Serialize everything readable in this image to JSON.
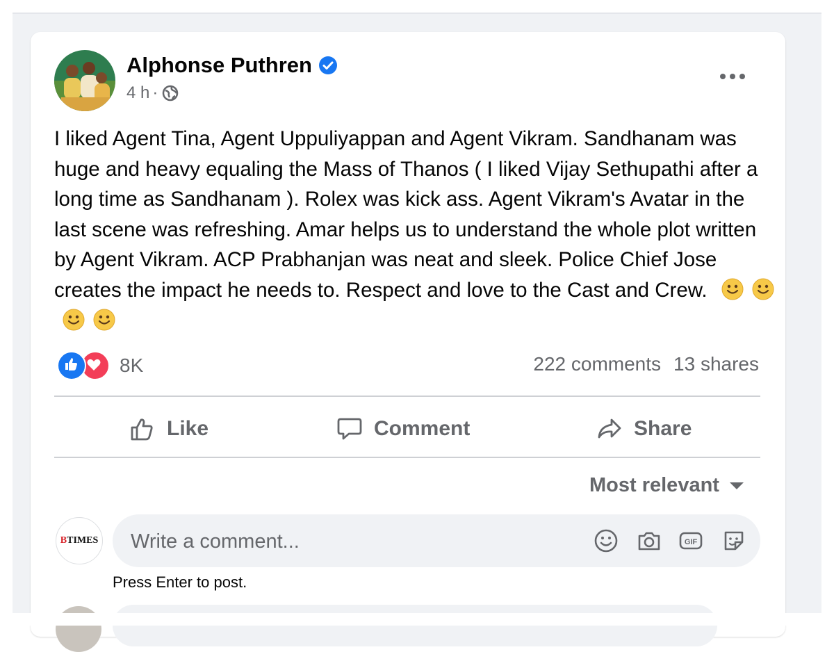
{
  "post": {
    "author": "Alphonse Puthren",
    "time": "4 h",
    "separator": "·",
    "text": "I liked Agent Tina, Agent Uppuliyappan and Agent Vikram. Sandhanam was huge and heavy equaling the Mass of Thanos ( I liked Vijay Sethupathi after a long time as Sandhanam ). Rolex was kick ass. Agent Vikram's Avatar in the last scene was refreshing. Amar helps us to understand the whole plot written by Agent Vikram. ACP Prabhanjan was neat and sleek. Police Chief Jose creates the impact he needs to. Respect and love to the Cast and Crew.",
    "emojis": [
      "slightly-smiling-face",
      "slightly-smiling-face",
      "slightly-smiling-face",
      "slightly-smiling-face"
    ]
  },
  "stats": {
    "reaction_count": "8K",
    "comments": "222 comments",
    "shares": "13 shares"
  },
  "actions": {
    "like": "Like",
    "comment": "Comment",
    "share": "Share"
  },
  "comments_section": {
    "sort_label": "Most relevant",
    "placeholder": "Write a comment...",
    "hint": "Press Enter to post.",
    "page_logo": "TIMES",
    "page_logo_prefix": "B"
  },
  "icons": [
    "verified-badge-icon",
    "globe-icon",
    "more-icon",
    "like-reaction-icon",
    "love-reaction-icon",
    "thumbs-up-icon",
    "comment-bubble-icon",
    "share-arrow-icon",
    "caret-down-icon",
    "emoji-icon",
    "camera-icon",
    "gif-icon",
    "sticker-icon"
  ],
  "colors": {
    "brand_blue": "#1877f2",
    "love_red": "#f33e58",
    "secondary_text": "#65676b",
    "background": "#f0f2f5"
  }
}
